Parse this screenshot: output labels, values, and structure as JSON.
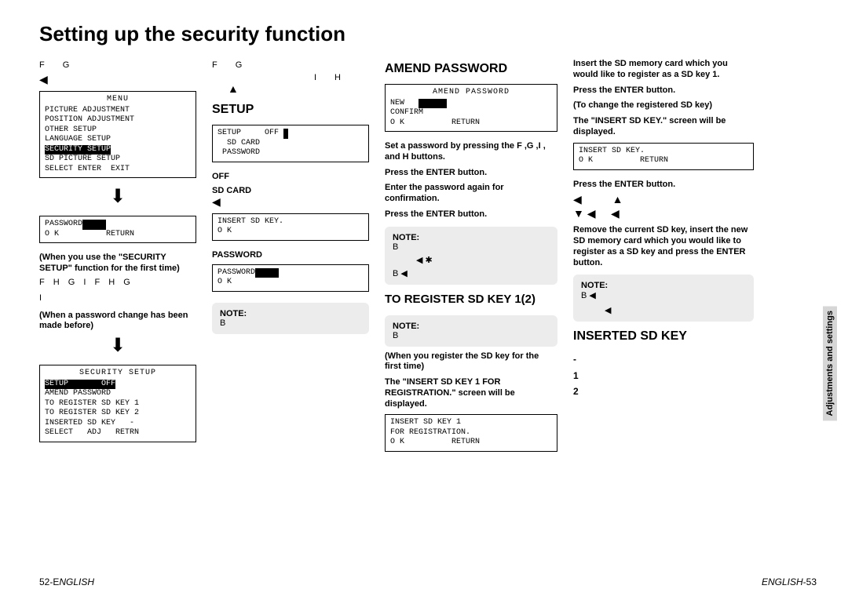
{
  "page": {
    "title": "Setting up the security function"
  },
  "c1": {
    "letters1": "F     G",
    "menu": {
      "title": "MENU",
      "items": [
        "PICTURE ADJUSTMENT",
        "POSITION ADJUSTMENT",
        "OTHER SETUP",
        "LANGUAGE SETUP",
        "SECURITY SETUP",
        "SD PICTURE SETUP"
      ],
      "footer": "SELECT ENTER  EXIT"
    },
    "pw_box": {
      "line1": "PASSWORD",
      "line2": "O K          RETURN"
    },
    "instr1": "(When you use the \"SECURITY SETUP\" function for the first time)",
    "letters2": "F  H   G  I   F  H   G",
    "letters3": "I",
    "instr2": "(When a password change has been made before)",
    "sec_box": {
      "title": "SECURITY SETUP",
      "line_setup": "SETUP       OFF",
      "items": [
        "AMEND PASSWORD",
        "TO REGISTER SD KEY 1",
        "TO REGISTER SD KEY 2",
        "INSERTED SD KEY   -"
      ],
      "footer": "SELECT   ADJ   RETRN"
    }
  },
  "c2": {
    "letters1": "F     G",
    "ih": "I   H",
    "setup_title": "SETUP",
    "setup_box": {
      "l1": "SETUP     OFF",
      "l2": "  SD CARD",
      "l3": " PASSWORD"
    },
    "sub_off": "OFF",
    "sub_sd": "SD CARD",
    "sd_box": {
      "l1": "INSERT SD KEY.",
      "l2": "O K"
    },
    "sub_pw": "PASSWORD",
    "pw_box": {
      "l1": "PASSWORD",
      "l2": "O K"
    },
    "note": {
      "h": "NOTE:",
      "b": "B"
    }
  },
  "c3": {
    "amend_title": "AMEND PASSWORD",
    "amend_box": {
      "title": "AMEND PASSWORD",
      "l1": "NEW",
      "l2": "CONFIRM",
      "l3": "O K          RETURN"
    },
    "instr1": "Set a password by pressing the F ,G ,I  , and H  buttons.",
    "instr2": "Press the ENTER button.",
    "instr3": "Enter the password again for confirmation.",
    "instr4": "Press the ENTER button.",
    "note1": {
      "h": "NOTE:",
      "b1": "B",
      "star": "◀  ✱",
      "b2": "B ◀"
    },
    "reg_title": "TO REGISTER SD KEY 1(2)",
    "note2": {
      "h": "NOTE:",
      "b": "B"
    },
    "instr5": "(When you register the SD key for the first time)",
    "instr6": "The \"INSERT SD KEY 1 FOR REGISTRATION.\" screen will be displayed.",
    "reg_box": {
      "l1": "INSERT SD KEY 1",
      "l2": "FOR REGISTRATION.",
      "l3": "O K          RETURN"
    }
  },
  "c4": {
    "instr1": "Insert the SD memory card which you would like to register as a SD key 1.",
    "instr2": "Press the ENTER button.",
    "instr3": "(To change the registered SD key)",
    "instr4": "The \"INSERT SD KEY.\" screen will be displayed.",
    "ins_box": {
      "l1": "INSERT SD KEY.",
      "l2": "O K          RETURN"
    },
    "instr5": "Press the ENTER button.",
    "arrows": "◀          ▲\n▼ ◀     ◀",
    "instr6": "Remove the current SD key, insert the new SD memory card which you would like to register as a SD key and press the ENTER button.",
    "note": {
      "h": "NOTE:",
      "b": "B ◀",
      "ar": "◀"
    },
    "inserted_title": "INSERTED SD KEY",
    "list": {
      "dash": "-",
      "one": "1",
      "two": "2"
    }
  },
  "footer": {
    "left": "52-ENGLISH",
    "right": "ENGLISH-53"
  },
  "side": "Adjustments and settings"
}
